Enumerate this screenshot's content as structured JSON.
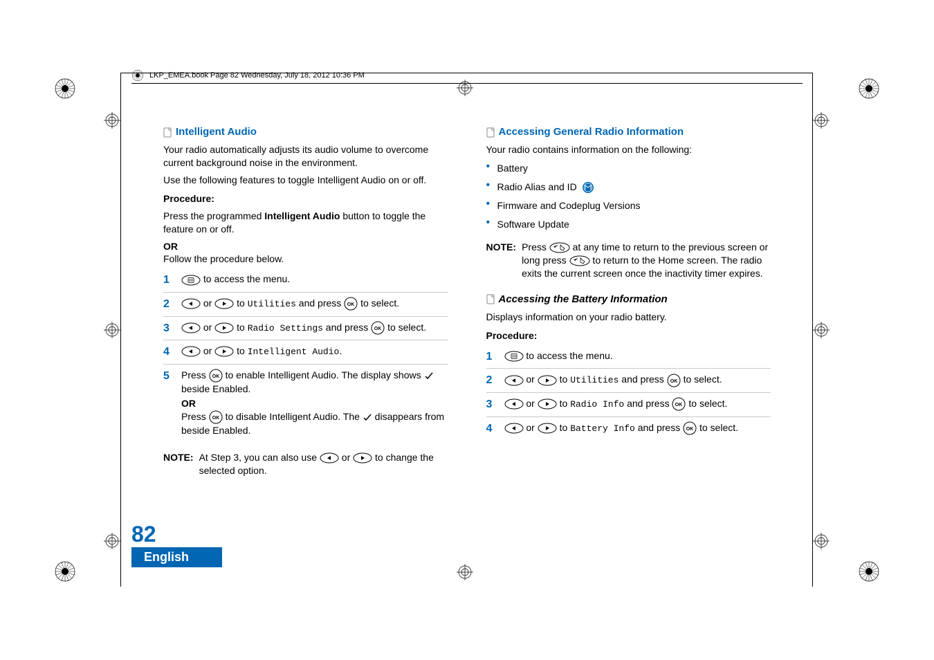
{
  "header": {
    "text": "LKP_EMEA.book  Page 82  Wednesday, July 18, 2012  10:36 PM"
  },
  "left": {
    "title": "Intelligent Audio",
    "p1": "Your radio automatically adjusts its audio volume to overcome current background noise in the environment.",
    "p2": "Use the following features to toggle Intelligent Audio on or off.",
    "procedure": "Procedure:",
    "press_pre": "Press the programmed ",
    "ia_button": "Intelligent Audio",
    "press_post": " button to toggle the feature on or off.",
    "or": "OR",
    "follow": "Follow the procedure below.",
    "step1_post": " to access the menu.",
    "or_mid": " or ",
    "to": " to ",
    "utilities": "Utilities",
    "and_press": " and press ",
    "to_select": " to select.",
    "radio_settings": "Radio Settings",
    "intelligent_audio_item": "Intelligent Audio",
    "step5_pre": "Press ",
    "step5_mid1": " to enable Intelligent Audio. The display shows ",
    "step5_post": " beside Enabled.",
    "step5_or": "OR",
    "step5b_pre": "Press ",
    "step5b_mid": " to disable Intelligent Audio. The ",
    "step5b_post": " disappears from beside Enabled.",
    "note_label": "NOTE:",
    "note_pre": "At Step 3, you can also use ",
    "note_mid": " or ",
    "note_post": " to change the selected option.",
    "nums": {
      "s1": "1",
      "s2": "2",
      "s3": "3",
      "s4": "4",
      "s5": "5"
    }
  },
  "right": {
    "title": "Accessing General Radio Information",
    "intro": "Your radio contains information on the following:",
    "items": {
      "battery": "Battery",
      "alias": "Radio Alias and ID",
      "fw": "Firmware and Codeplug Versions",
      "sw": "Software Update"
    },
    "note_label": "NOTE:",
    "note_pre": "Press ",
    "note_mid1": " at any time to return to the previous screen or long press ",
    "note_post": " to return to the Home screen. The radio exits the current screen once the inactivity timer expires.",
    "sub_title": "Accessing the Battery Information",
    "sub_intro": "Displays information on your radio battery.",
    "procedure": "Procedure:",
    "step1_post": " to access the menu.",
    "or_mid": " or ",
    "to": " to ",
    "utilities": "Utilities",
    "and_press": " and press ",
    "to_select": " to select.",
    "radio_info": "Radio Info",
    "battery_info": "Battery Info",
    "nums": {
      "s1": "1",
      "s2": "2",
      "s3": "3",
      "s4": "4"
    }
  },
  "footer": {
    "page": "82",
    "lang": "English"
  }
}
